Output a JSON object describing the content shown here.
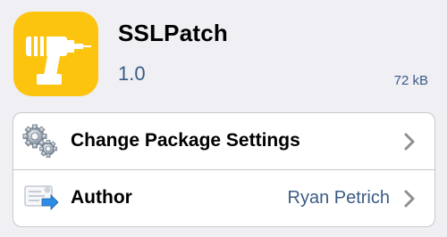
{
  "package": {
    "name": "SSLPatch",
    "version": "1.0",
    "size": "72 kB",
    "icon": "drill-icon"
  },
  "actions": {
    "settings": {
      "label": "Change Package Settings",
      "icon": "gears-icon"
    },
    "author": {
      "label": "Author",
      "value": "Ryan Petrich",
      "icon": "contact-card-icon"
    }
  },
  "colors": {
    "accent_text": "#3a5b86",
    "icon_background": "#fcc40f",
    "page_background": "#efeff4"
  }
}
